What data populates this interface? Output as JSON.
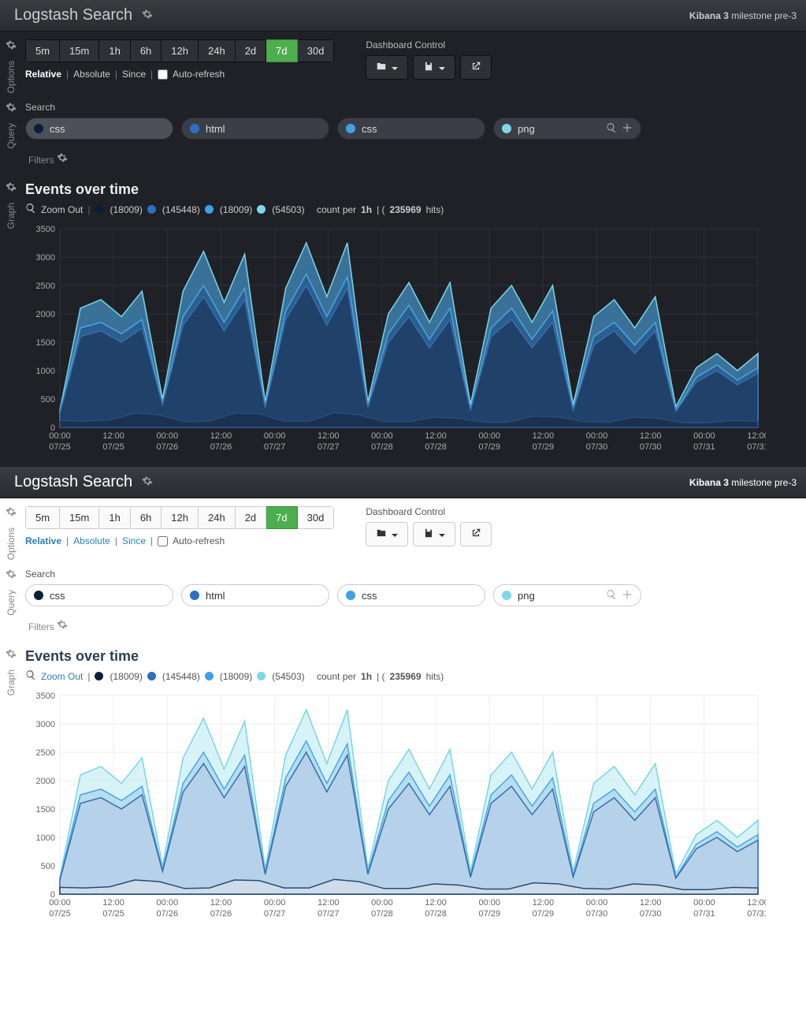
{
  "header": {
    "title": "Logstash Search",
    "brand_bold": "Kibana 3",
    "brand_rest": "milestone pre-3"
  },
  "rails": {
    "options": "Options",
    "query": "Query",
    "graph": "Graph"
  },
  "dashboard_control_label": "Dashboard Control",
  "time_ranges": [
    "5m",
    "15m",
    "1h",
    "6h",
    "12h",
    "24h",
    "2d",
    "7d",
    "30d"
  ],
  "time_active": "7d",
  "modes": {
    "relative": "Relative",
    "absolute": "Absolute",
    "since": "Since",
    "auto_refresh": "Auto-refresh"
  },
  "search_label": "Search",
  "queries": [
    {
      "text": "css",
      "color": "#0b1e3a"
    },
    {
      "text": "html",
      "color": "#2d6fc1"
    },
    {
      "text": "css",
      "color": "#3fa0e8"
    },
    {
      "text": "png",
      "color": "#7fd6e8",
      "actions": true
    }
  ],
  "filters_label": "Filters",
  "graph_title": "Events over time",
  "legend": {
    "zoom": "Zoom Out",
    "items": [
      {
        "count": "(18009)",
        "color": "#0b1e3a"
      },
      {
        "count": "(145448)",
        "color": "#2d6fc1"
      },
      {
        "count": "(18009)",
        "color": "#3fa0e8"
      },
      {
        "count": "(54503)",
        "color": "#7fd6e8"
      }
    ],
    "interval_prefix": "count per ",
    "interval": "1h",
    "hits_prefix": " | (",
    "hits": "235969",
    "hits_suffix": " hits)"
  },
  "chart_data": {
    "type": "area",
    "title": "Events over time",
    "ylabel": "",
    "ylim": [
      0,
      3500
    ],
    "yticks": [
      0,
      500,
      1000,
      1500,
      2000,
      2500,
      3000,
      3500
    ],
    "x_categories": [
      "00:00 07/25",
      "12:00 07/25",
      "00:00 07/26",
      "12:00 07/26",
      "00:00 07/27",
      "12:00 07/27",
      "00:00 07/28",
      "12:00 07/28",
      "00:00 07/29",
      "12:00 07/29",
      "00:00 07/30",
      "12:00 07/30",
      "00:00 07/31",
      "12:00 07/31"
    ],
    "series": [
      {
        "name": "css",
        "legend_count": 18009,
        "color": "#0b1e3a",
        "values": [
          120,
          110,
          130,
          250,
          220,
          100,
          110,
          250,
          240,
          110,
          110,
          260,
          220,
          100,
          100,
          180,
          160,
          90,
          90,
          200,
          180,
          100,
          90,
          180,
          160,
          80,
          80,
          120,
          110
        ]
      },
      {
        "name": "html",
        "legend_count": 145448,
        "color": "#2d6fc1",
        "values": [
          250,
          1600,
          1700,
          1500,
          1750,
          400,
          1800,
          2300,
          1700,
          2250,
          350,
          1900,
          2500,
          1800,
          2450,
          350,
          1500,
          1950,
          1400,
          1900,
          300,
          1600,
          1900,
          1400,
          1850,
          300,
          1450,
          1700,
          1300,
          1700,
          280,
          800,
          1000,
          750,
          950
        ]
      },
      {
        "name": "css",
        "legend_count": 18009,
        "color": "#3fa0e8",
        "values": [
          270,
          1750,
          1850,
          1650,
          1900,
          430,
          1950,
          2500,
          1850,
          2450,
          380,
          2050,
          2700,
          1950,
          2650,
          380,
          1650,
          2150,
          1550,
          2100,
          330,
          1750,
          2100,
          1550,
          2050,
          330,
          1600,
          1850,
          1450,
          1850,
          300,
          880,
          1100,
          830,
          1050
        ]
      },
      {
        "name": "png",
        "legend_count": 54503,
        "color": "#7fd6e8",
        "values": [
          300,
          2100,
          2250,
          1950,
          2400,
          500,
          2400,
          3100,
          2200,
          3050,
          450,
          2450,
          3250,
          2300,
          3250,
          450,
          2000,
          2550,
          1850,
          2550,
          400,
          2100,
          2500,
          1850,
          2500,
          400,
          1950,
          2250,
          1750,
          2300,
          360,
          1050,
          1300,
          1000,
          1300
        ]
      }
    ]
  }
}
